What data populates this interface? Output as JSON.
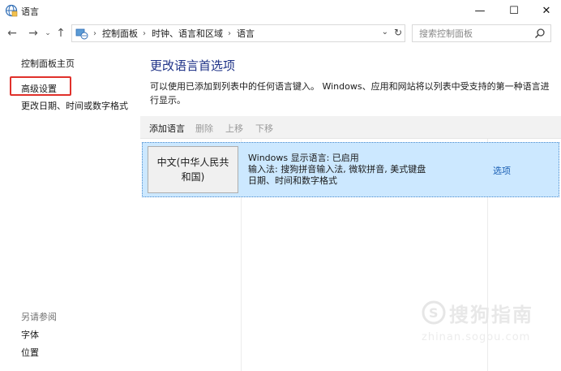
{
  "window": {
    "title": "语言",
    "minimize_label": "—",
    "maximize_label": "☐",
    "close_label": "✕"
  },
  "nav": {
    "back_label": "←",
    "forward_label": "→",
    "recent_label": "⌄",
    "up_label": "↑"
  },
  "address": {
    "breadcrumbs": [
      "控制面板",
      "时钟、语言和区域",
      "语言"
    ],
    "dropdown_label": "⌄",
    "refresh_label": "↻"
  },
  "search": {
    "placeholder": "搜索控制面板"
  },
  "sidebar": {
    "home": "控制面板主页",
    "advanced": "高级设置",
    "change_date": "更改日期、时间或数字格式",
    "see_also_label": "另请参阅",
    "fonts": "字体",
    "location": "位置"
  },
  "main": {
    "heading": "更改语言首选项",
    "description": "可以使用已添加到列表中的任何语言键入。 Windows、应用和网站将以列表中受支持的第一种语言进行显示。"
  },
  "toolbar": {
    "add": "添加语言",
    "remove": "删除",
    "move_up": "上移",
    "move_down": "下移"
  },
  "languages": [
    {
      "name": "中文(中华人民共和国)",
      "display_status": "Windows 显示语言: 已启用",
      "input_methods": "输入法: 搜狗拼音输入法, 微软拼音, 美式键盘",
      "formats": "日期、时间和数字格式",
      "options": "选项"
    }
  ],
  "watermark": {
    "main": "搜狗指南",
    "sub": "zhinan.sogou.com"
  },
  "colors": {
    "heading": "#1e3287",
    "link": "#1a5fb4",
    "selected_row": "#cce8ff",
    "highlight_box": "#e0312b"
  }
}
